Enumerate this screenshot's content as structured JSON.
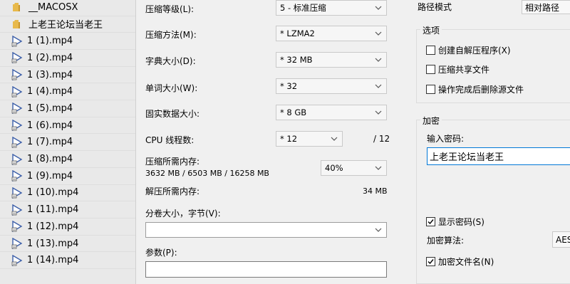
{
  "file_list": [
    {
      "name": "__MACOSX",
      "type": "folder"
    },
    {
      "name": "上老王论坛当老王",
      "type": "folder"
    },
    {
      "name": "1 (1).mp4",
      "type": "video"
    },
    {
      "name": "1 (2).mp4",
      "type": "video"
    },
    {
      "name": "1 (3).mp4",
      "type": "video"
    },
    {
      "name": "1 (4).mp4",
      "type": "video"
    },
    {
      "name": "1 (5).mp4",
      "type": "video"
    },
    {
      "name": "1 (6).mp4",
      "type": "video"
    },
    {
      "name": "1 (7).mp4",
      "type": "video"
    },
    {
      "name": "1 (8).mp4",
      "type": "video"
    },
    {
      "name": "1 (9).mp4",
      "type": "video"
    },
    {
      "name": "1 (10).mp4",
      "type": "video"
    },
    {
      "name": "1 (11).mp4",
      "type": "video"
    },
    {
      "name": "1 (12).mp4",
      "type": "video"
    },
    {
      "name": "1 (13).mp4",
      "type": "video"
    },
    {
      "name": "1 (14).mp4",
      "type": "video"
    }
  ],
  "settings": {
    "level_label": "压缩等级(L):",
    "level_value": "5 - 标准压缩",
    "method_label": "压缩方法(M):",
    "method_value": "* LZMA2",
    "dict_label": "字典大小(D):",
    "dict_value": "* 32 MB",
    "word_label": "单词大小(W):",
    "word_value": "* 32",
    "solid_label": "固实数据大小:",
    "solid_value": "* 8 GB",
    "threads_label": "CPU 线程数:",
    "threads_value": "* 12",
    "threads_max": "/ 12",
    "mem_label": "压缩所需内存:",
    "mem_detail": "3632 MB / 6503 MB / 16258 MB",
    "mem_percent": "40%",
    "decomp_label": "解压所需内存:",
    "decomp_value": "34 MB",
    "volume_label": "分卷大小，字节(V):",
    "volume_value": "",
    "params_label": "参数(P):",
    "params_value": ""
  },
  "right": {
    "path_mode_label": "路径模式",
    "path_mode_value": "相对路径",
    "options_title": "选项",
    "opt_sfx": "创建自解压程序(X)",
    "opt_shared": "压缩共享文件",
    "opt_delete": "操作完成后删除源文件",
    "encrypt_title": "加密",
    "password_label": "输入密码:",
    "password_value": "上老王论坛当老王",
    "show_password": "显示密码(S)",
    "enc_method_label": "加密算法:",
    "enc_method_value": "AES",
    "enc_filenames": "加密文件名(N)"
  },
  "checkbox_states": {
    "opt_sfx": false,
    "opt_shared": false,
    "opt_delete": false,
    "show_password": true,
    "enc_filenames": true
  },
  "colors": {
    "folder": "#e8b94b",
    "video_icon": "#3b5ea8",
    "focus_border": "#0078d7"
  }
}
